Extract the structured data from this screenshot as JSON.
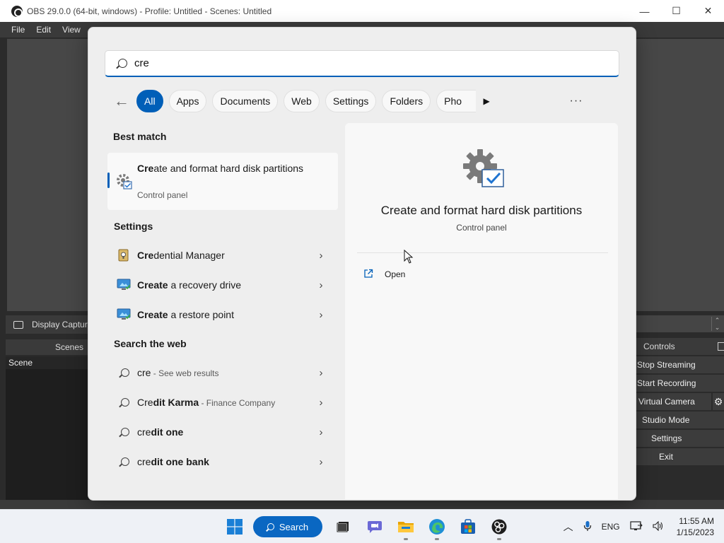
{
  "obs": {
    "title": "OBS 29.0.0 (64-bit, windows) - Profile: Untitled - Scenes: Untitled",
    "menu": [
      "File",
      "Edit",
      "View"
    ],
    "source_bar_label": "Display Captur",
    "scenes_header": "Scenes",
    "scene_item": "Scene",
    "controls_header": "Controls",
    "controls": {
      "stop_streaming": "Stop Streaming",
      "start_recording": "Start Recording",
      "virtual_camera": "Virtual Camera",
      "studio_mode": "Studio Mode",
      "settings": "Settings",
      "exit": "Exit"
    }
  },
  "search": {
    "query": "cre",
    "filters": [
      "All",
      "Apps",
      "Documents",
      "Web",
      "Settings",
      "Folders",
      "Pho"
    ],
    "active_filter": "All",
    "more": "···",
    "best_match_header": "Best match",
    "best_match": {
      "bold": "Cre",
      "rest": "ate and format hard disk partitions",
      "category": "Control panel"
    },
    "settings_header": "Settings",
    "settings_items": [
      {
        "bold": "Cre",
        "rest": "dential Manager",
        "icon": "credential-manager-icon"
      },
      {
        "bold": "Create",
        "rest": " a recovery drive",
        "icon": "monitor-icon"
      },
      {
        "bold": "Create",
        "rest": " a restore point",
        "icon": "monitor-icon"
      }
    ],
    "web_header": "Search the web",
    "web_items": [
      {
        "bold": "",
        "rest": "cre",
        "sub": " - See web results"
      },
      {
        "bold": "Cre",
        "rest": "dit Karma",
        "sub": " - Finance Company"
      },
      {
        "bold": "cre",
        "rest": "dit one",
        "sub": ""
      },
      {
        "bold": "cre",
        "rest": "dit one bank",
        "sub": ""
      }
    ],
    "preview": {
      "title": "Create and format hard disk partitions",
      "subtitle": "Control panel",
      "open_label": "Open"
    }
  },
  "taskbar": {
    "search_label": "Search",
    "language": "ENG",
    "time": "11:55 AM",
    "date": "1/15/2023"
  },
  "colors": {
    "accent": "#005fb8",
    "taskbar_search": "#0a67c2",
    "obs_panel": "#3a3a3a"
  }
}
